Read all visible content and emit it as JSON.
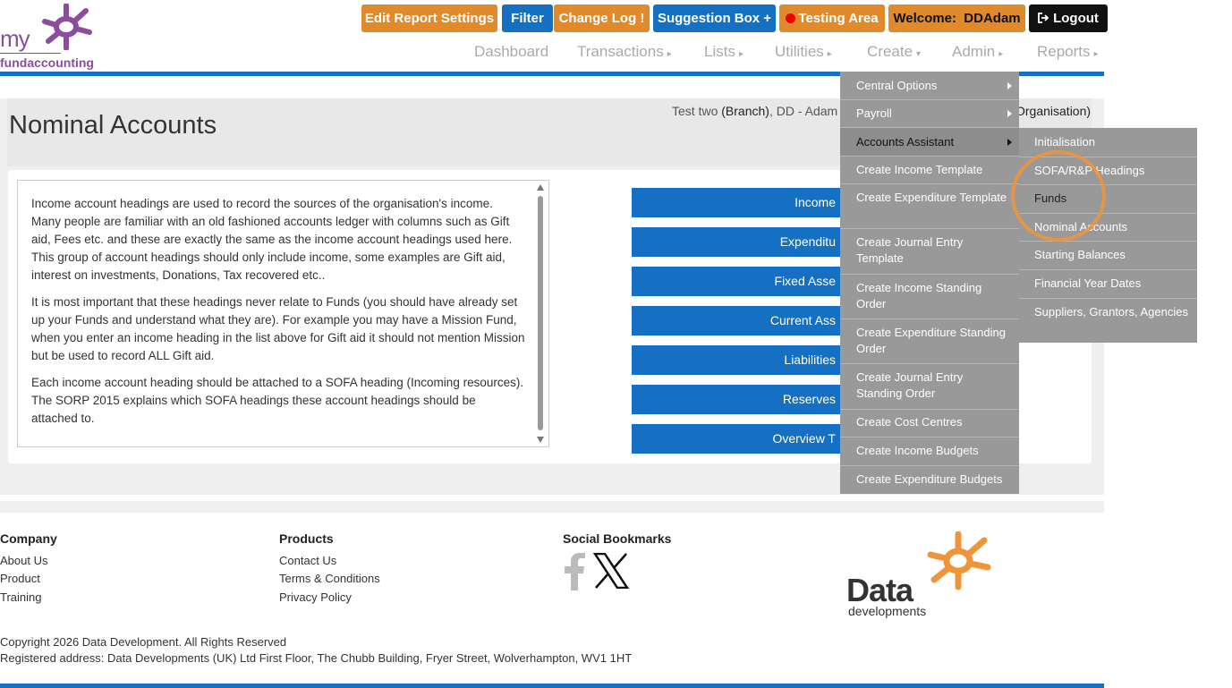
{
  "logo": {
    "line1": "my",
    "line2": "fundaccounting"
  },
  "header": {
    "buttons": {
      "edit_report": "Edit Report Settings",
      "filter": "Filter",
      "change_log": "Change Log",
      "change_log_badge": "!",
      "suggestion": "Suggestion Box",
      "suggestion_icon": "+",
      "testing": "Testing Area",
      "welcome_label": "Welcome:",
      "welcome_user": "DDAdam",
      "logout": "Logout"
    },
    "nav": [
      "Dashboard",
      "Transactions",
      "Lists",
      "Utilities",
      "Create",
      "Admin",
      "Reports"
    ]
  },
  "page": {
    "title": "Nominal Accounts",
    "org_prefix": "Test two",
    "org_branch": "(Branch)",
    "org_mid": ", DD - Adam",
    "org_tail": "Organisation)"
  },
  "info": {
    "paragraphs": [
      "Income account headings are used to record the sources of the organisation's income. Many people are familiar with an old fashioned accounts ledger with columns such as Gift aid, Fees etc. and these are exactly the same as the income account headings used here. This group of account headings should only include income, some examples are Gift aid, interest on investments, Donations, Tax recovered etc..",
      "It is most important that these headings never relate to Funds (you should have already set up your Funds and understand what they are). For example you may have a Mission Fund, when you enter an income heading in the list above for Gift aid it should not mention Mission but be used to record ALL Gift aid.",
      "Each income account heading should be attached to a SOFA heading (Incoming resources). The SORP 2015 explains which SOFA headings these account headings should be attached to."
    ]
  },
  "categories": [
    "Income",
    "Expenditu",
    "Fixed Asse",
    "Current Ass",
    "Liabilities",
    "Reserves",
    "Overview T"
  ],
  "create_menu": [
    "Central Options",
    "Payroll",
    "Accounts Assistant",
    "Create Income Template",
    "Create Expenditure Template",
    "Create Journal Entry Template",
    "Create Income Standing Order",
    "Create Expenditure Standing Order",
    "Create Journal Entry Standing Order",
    "Create Cost Centres",
    "Create Income Budgets",
    "Create Expenditure Budgets"
  ],
  "assistant_menu": [
    "Initialisation",
    "SOFA/R&P Headings",
    "Funds",
    "Nominal Accounts",
    "Starting Balances",
    "Financial Year Dates",
    "Suppliers, Grantors, Agencies"
  ],
  "footer": {
    "company_head": "Company",
    "company_links": [
      "About Us",
      "Product",
      "Training"
    ],
    "products_head": "Products",
    "products_links": [
      "Contact Us",
      "Terms & Conditions",
      "Privacy Policy"
    ],
    "social_head": "Social Bookmarks",
    "dd_word": "Data",
    "dd_sub": "developments",
    "copyright": "Copyright 2026 Data Development. All Rights Reserved",
    "address": "Registered address: Data Developments (UK) Ltd First Floor, The Chubb Building, Fryer Street, Wolverhampton, WV1 1HT"
  },
  "colors": {
    "brand_blue": "#1570c4",
    "orange": "#e08a2c",
    "menu_grey": "#999999",
    "logo_purple": "#8b4d9c"
  }
}
